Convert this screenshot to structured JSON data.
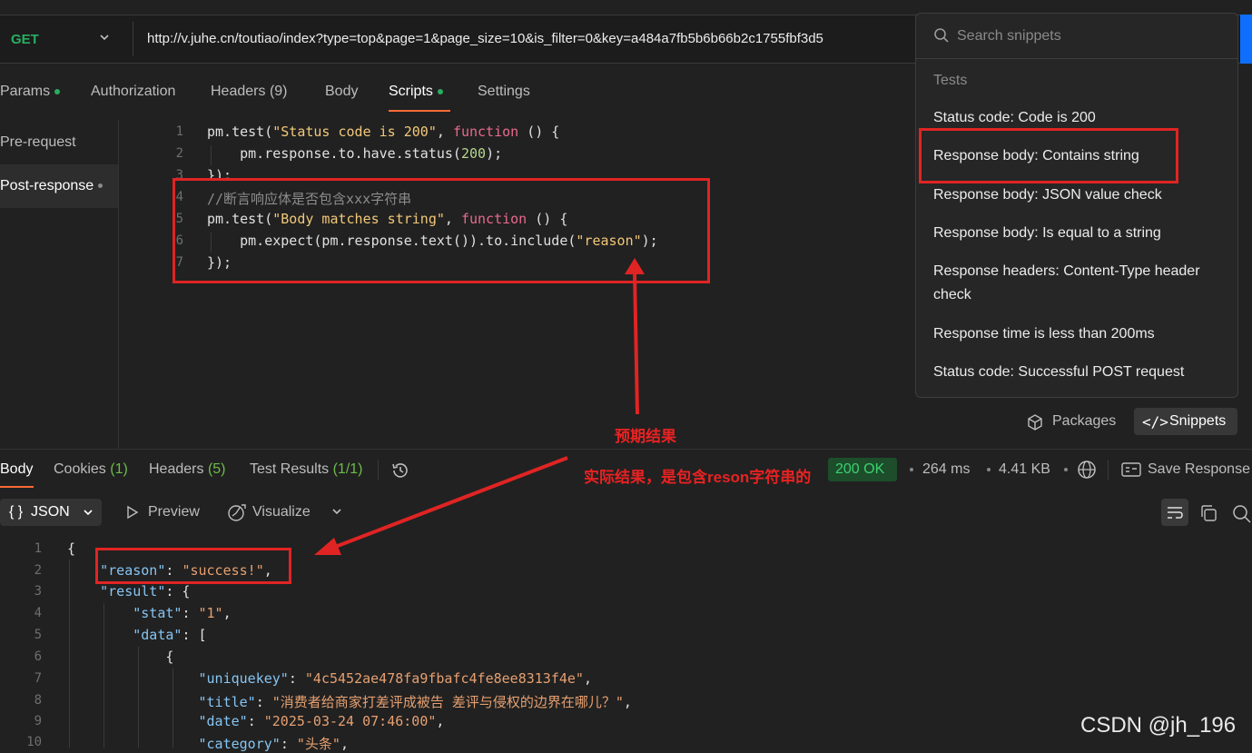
{
  "request": {
    "method": "GET",
    "url": "http://v.juhe.cn/toutiao/index?type=top&page=1&page_size=10&is_filter=0&key=a484a7fb5b6b66b2c1755fbf3d5"
  },
  "request_tabs": {
    "params": "Params",
    "authorization": "Authorization",
    "headers": "Headers",
    "headers_count": "(9)",
    "body": "Body",
    "scripts": "Scripts",
    "settings": "Settings"
  },
  "scripts_side": {
    "pre_request": "Pre-request",
    "post_response": "Post-response"
  },
  "editor": {
    "line_numbers": [
      "1",
      "2",
      "3",
      "4",
      "5",
      "6",
      "7"
    ]
  },
  "snippets": {
    "search_placeholder": "Search snippets",
    "section": "Tests",
    "items": [
      "Status code: Code is 200",
      "Response body: Contains string",
      "Response body: JSON value check",
      "Response body: Is equal to a string",
      "Response headers: Content-Type header check",
      "Response time is less than 200ms",
      "Status code: Successful POST request"
    ],
    "packages_label": "Packages",
    "snippets_label": "Snippets",
    "snippets_icon": "</>"
  },
  "response_tabs": {
    "body": "Body",
    "cookies": "Cookies",
    "cookies_count": "(1)",
    "headers": "Headers",
    "headers_count": "(5)",
    "test_results": "Test Results",
    "test_results_count": "(1/1)"
  },
  "response_meta": {
    "status": "200 OK",
    "time": "264 ms",
    "size": "4.41 KB",
    "save_response": "Save Response"
  },
  "response_view": {
    "format": "{ }  JSON",
    "preview": "Preview",
    "visualize": "Visualize"
  },
  "response_body": {
    "line_numbers": [
      "1",
      "2",
      "3",
      "4",
      "5",
      "6",
      "7",
      "8",
      "9",
      "10"
    ]
  },
  "annotations": {
    "expected": "预期结果",
    "actual": "实际结果，是包含reson字符串的"
  },
  "watermark": "CSDN @jh_196",
  "colors": {
    "accent": "#ff6c37",
    "method_get": "#27ae60",
    "annotation_red": "#e02424"
  }
}
